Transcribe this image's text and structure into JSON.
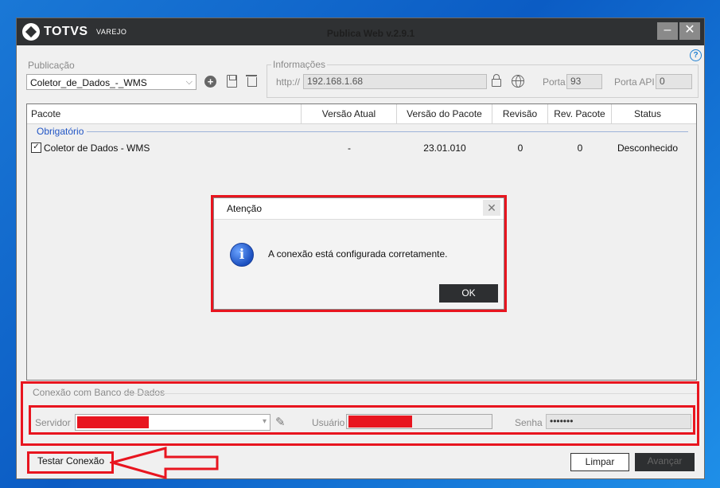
{
  "window": {
    "brand": "TOTVS",
    "brand_sub": "VAREJO",
    "title": "Publica Web v.2.9.1",
    "minimize": "–",
    "close": "✕",
    "help": "?"
  },
  "publicacao": {
    "label": "Publicação",
    "value": "Coletor_de_Dados_-_WMS",
    "icons": [
      "add-icon",
      "save-icon",
      "trash-icon"
    ]
  },
  "informacoes": {
    "label": "Informações",
    "protocol": "http://",
    "host": "192.168.1.68",
    "porta_label": "Porta",
    "porta": "93",
    "porta_api_label": "Porta API",
    "porta_api": "0"
  },
  "table": {
    "columns": [
      "Pacote",
      "Versão Atual",
      "Versão do Pacote",
      "Revisão",
      "Rev. Pacote",
      "Status"
    ],
    "group": "Obrigatório",
    "rows": [
      {
        "checked": "✓",
        "pacote": "Coletor de Dados - WMS",
        "versao_atual": "-",
        "versao_pacote": "23.01.010",
        "revisao": "0",
        "rev_pacote": "0",
        "status": "Desconhecido"
      }
    ]
  },
  "dialog": {
    "title": "Atenção",
    "close": "✕",
    "icon": "i",
    "message": "A conexão está configurada corretamente.",
    "ok": "OK"
  },
  "conexao": {
    "group_label": "Conexão com Banco de Dados",
    "servidor_label": "Servidor",
    "usuario_label": "Usuário",
    "senha_label": "Senha",
    "senha_value": "•••••••"
  },
  "buttons": {
    "testar": "Testar Conexão",
    "limpar": "Limpar",
    "avancar": "Avançar"
  },
  "colors": {
    "annotation_red": "#e8151f",
    "titlebar": "#2f3133",
    "group_blue": "#2155c5"
  }
}
